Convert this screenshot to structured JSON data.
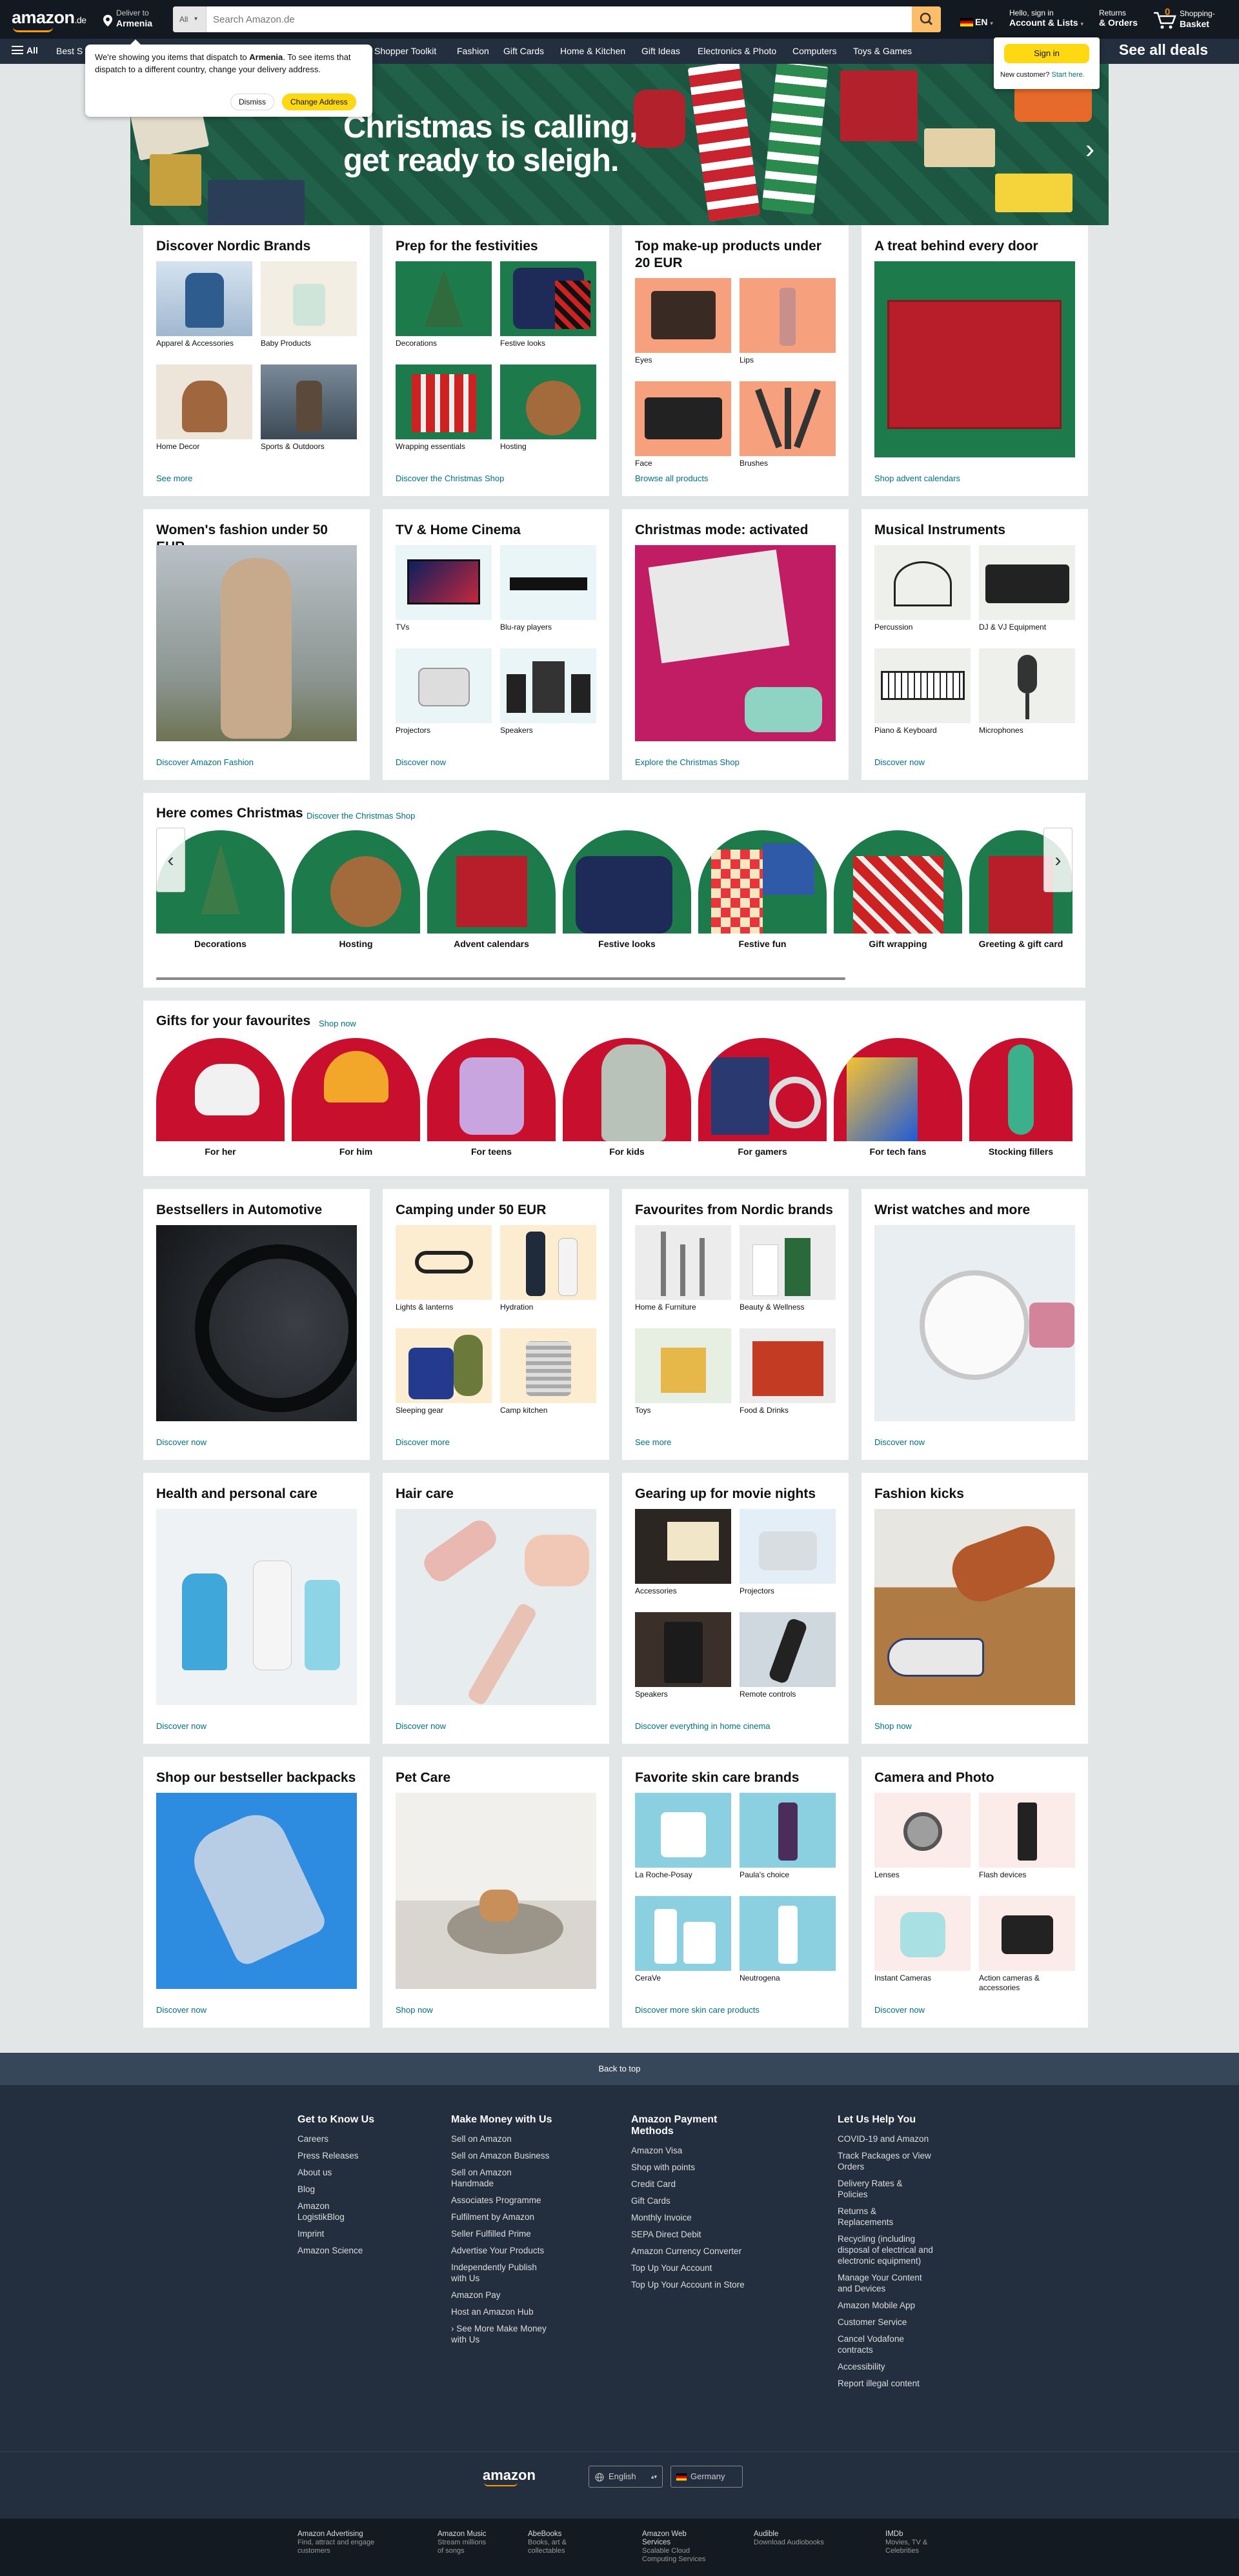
{
  "nav": {
    "logo": "amazon",
    "tld": ".de",
    "deliver_line1": "Deliver to",
    "deliver_line2": "Armenia",
    "search_category": "All",
    "search_placeholder": "Search Amazon.de",
    "lang": "EN",
    "account_line1": "Hello, sign in",
    "account_line2": "Account & Lists",
    "orders_line1": "Returns",
    "orders_line2": "& Orders",
    "cart_count": "0",
    "cart_line1": "Shopping-",
    "cart_line2": "Basket"
  },
  "subnav": {
    "all_label": "All",
    "links": [
      "Best S",
      "Shopper Toolkit",
      "Fashion",
      "Gift Cards",
      "Home & Kitchen",
      "Gift Ideas",
      "Electronics & Photo",
      "Computers",
      "Toys & Games"
    ],
    "deals": "See all deals"
  },
  "glow_popover": {
    "text_before": "We're showing you items that dispatch to ",
    "country": "Armenia",
    "text_after": ". To see items that dispatch to a different country, change your delivery address.",
    "dismiss": "Dismiss",
    "change": "Change Address"
  },
  "signin_popover": {
    "button": "Sign in",
    "new_customer": "New customer?",
    "start_here": "Start here."
  },
  "hero": {
    "line1": "Christmas is calling,",
    "line2": "get ready to sleigh."
  },
  "cards_row1": [
    {
      "title": "Discover Nordic Brands",
      "items": [
        "Apparel & Accessories",
        "Baby Products",
        "Home Decor",
        "Sports & Outdoors"
      ],
      "footer": "See more"
    },
    {
      "title": "Prep for the festivities",
      "items": [
        "Decorations",
        "Festive looks",
        "Wrapping essentials",
        "Hosting"
      ],
      "footer": "Discover the Christmas Shop"
    },
    {
      "title": "Top make-up products under 20 EUR",
      "items": [
        "Eyes",
        "Lips",
        "Face",
        "Brushes"
      ],
      "footer": "Browse all products"
    },
    {
      "title": "A treat behind every door",
      "footer": "Shop advent calendars"
    }
  ],
  "cards_row2": [
    {
      "title": "Women's fashion under 50 EUR",
      "footer": "Discover Amazon Fashion"
    },
    {
      "title": "TV & Home Cinema",
      "items": [
        "TVs",
        "Blu-ray players",
        "Projectors",
        "Speakers"
      ],
      "footer": "Discover now"
    },
    {
      "title": "Christmas mode: activated",
      "footer": "Explore the Christmas Shop"
    },
    {
      "title": "Musical Instruments",
      "items": [
        "Percussion",
        "DJ & VJ Equipment",
        "Piano & Keyboard",
        "Microphones"
      ],
      "footer": "Discover now"
    }
  ],
  "christmas_row": {
    "title": "Here comes Christmas",
    "link": "Discover the Christmas Shop",
    "items": [
      "Decorations",
      "Hosting",
      "Advent calendars",
      "Festive looks",
      "Festive fun",
      "Gift wrapping",
      "Greeting & gift card"
    ]
  },
  "gifts_row": {
    "title": "Gifts for your favourites",
    "link": "Shop now",
    "items": [
      "For her",
      "For him",
      "For teens",
      "For kids",
      "For gamers",
      "For tech fans",
      "Stocking fillers"
    ]
  },
  "cards_row3": [
    {
      "title": "Bestsellers in Automotive",
      "footer": "Discover now"
    },
    {
      "title": "Camping under 50 EUR",
      "items": [
        "Lights & lanterns",
        "Hydration",
        "Sleeping gear",
        "Camp kitchen"
      ],
      "footer": "Discover more"
    },
    {
      "title": "Favourites from Nordic brands",
      "items": [
        "Home & Furniture",
        "Beauty & Wellness",
        "Toys",
        "Food & Drinks"
      ],
      "footer": "See more"
    },
    {
      "title": "Wrist watches and more",
      "footer": "Discover now"
    }
  ],
  "cards_row4": [
    {
      "title": "Health and personal care",
      "footer": "Discover now"
    },
    {
      "title": "Hair care",
      "footer": "Discover now"
    },
    {
      "title": "Gearing up for movie nights",
      "items": [
        "Accessories",
        "Projectors",
        "Speakers",
        "Remote controls"
      ],
      "footer": "Discover everything in home cinema"
    },
    {
      "title": "Fashion kicks",
      "footer": "Shop now"
    }
  ],
  "cards_row5": [
    {
      "title": "Shop our bestseller backpacks",
      "footer": "Discover now"
    },
    {
      "title": "Pet Care",
      "footer": "Shop now"
    },
    {
      "title": "Favorite skin care brands",
      "items": [
        "La Roche-Posay",
        "Paula's choice",
        "CeraVe",
        "Neutrogena"
      ],
      "footer": "Discover more skin care products"
    },
    {
      "title": "Camera and Photo",
      "items": [
        "Lenses",
        "Flash devices",
        "Instant Cameras",
        "Action cameras & accessories"
      ],
      "footer": "Discover now"
    }
  ],
  "footer": {
    "back_to_top": "Back to top",
    "columns": [
      {
        "title": "Get to Know Us",
        "links": [
          "Careers",
          "Press Releases",
          "About us",
          "Blog",
          "Amazon LogistikBlog",
          "Imprint",
          "Amazon Science"
        ]
      },
      {
        "title": "Make Money with Us",
        "links": [
          "Sell on Amazon",
          "Sell on Amazon Business",
          "Sell on Amazon Handmade",
          "Associates Programme",
          "Fulfilment by Amazon",
          "Seller Fulfilled Prime",
          "Advertise Your Products",
          "Independently Publish with Us",
          "Amazon Pay",
          "Host an Amazon Hub",
          "› See More Make Money with Us"
        ]
      },
      {
        "title": "Amazon Payment Methods",
        "links": [
          "Amazon Visa",
          "Shop with points",
          "Credit Card",
          "Gift Cards",
          "Monthly Invoice",
          "SEPA Direct Debit",
          "Amazon Currency Converter",
          "Top Up Your Account",
          "Top Up Your Account in Store"
        ]
      },
      {
        "title": "Let Us Help You",
        "links": [
          "COVID-19 and Amazon",
          "Track Packages or View Orders",
          "Delivery Rates & Policies",
          "Returns & Replacements",
          "Recycling (including disposal of electrical and electronic equipment)",
          "Manage Your Content and Devices",
          "Amazon Mobile App",
          "Customer Service",
          "Cancel Vodafone contracts",
          "Accessibility",
          "Report illegal content"
        ]
      }
    ],
    "logo": "amazon",
    "language": "English",
    "country": "Germany",
    "bottom": [
      {
        "t": "Amazon Advertising",
        "s": "Find, attract and engage customers"
      },
      {
        "t": "Amazon Music",
        "s": "Stream millions of songs"
      },
      {
        "t": "AbeBooks",
        "s": "Books, art & collectables"
      },
      {
        "t": "Amazon Web Services",
        "s": "Scalable Cloud Computing Services"
      },
      {
        "t": "Audible",
        "s": "Download Audiobooks"
      },
      {
        "t": "IMDb",
        "s": "Movies, TV & Celebrities"
      }
    ]
  },
  "colors": {
    "nav_dark": "#131921",
    "nav_sub": "#232f3e",
    "accent": "#febd69",
    "link": "#007185",
    "button_yellow": "#ffd814"
  }
}
